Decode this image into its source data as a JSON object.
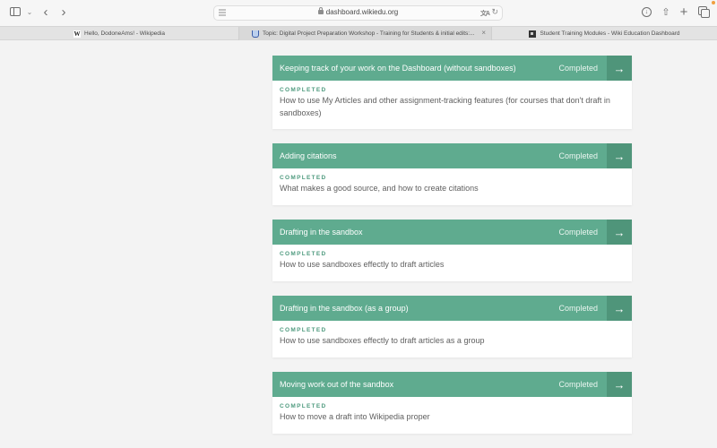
{
  "browser": {
    "url": "dashboard.wikiedu.org",
    "icons": {
      "sidebar": "sidebar-icon",
      "back": "‹",
      "forward": "›",
      "chevron_down": "⌄",
      "download": "↓",
      "share": "⇧",
      "new_tab": "+",
      "reload": "↻",
      "translate": "文A"
    },
    "tabs": [
      {
        "label": "Hello, DodoneAms! - Wikipedia",
        "favicon": "W",
        "active": false
      },
      {
        "label": "Topic: Digital Project Preparation Workshop - Training for Students & initial edits:...",
        "favicon": "U",
        "active": true,
        "close": "×"
      },
      {
        "label": "Student Training Modules - Wiki Education Dashboard",
        "favicon": "wiki-edu",
        "active": false
      }
    ]
  },
  "theme": {
    "header_color": "#5fab8f",
    "arrow_color": "#4f957a",
    "completed_label_color": "#4e9a7e"
  },
  "modules": [
    {
      "title": "Keeping track of your work on the Dashboard (without sandboxes)",
      "status": "Completed",
      "arrow": "→",
      "label": "COMPLETED",
      "description": "How to use My Articles and other assignment-tracking features (for courses that don't draft in sandboxes)"
    },
    {
      "title": "Adding citations",
      "status": "Completed",
      "arrow": "→",
      "label": "COMPLETED",
      "description": "What makes a good source, and how to create citations"
    },
    {
      "title": "Drafting in the sandbox",
      "status": "Completed",
      "arrow": "→",
      "label": "COMPLETED",
      "description": "How to use sandboxes effectly to draft articles"
    },
    {
      "title": "Drafting in the sandbox (as a group)",
      "status": "Completed",
      "arrow": "→",
      "label": "COMPLETED",
      "description": "How to use sandboxes effectly to draft articles as a group"
    },
    {
      "title": "Moving work out of the sandbox",
      "status": "Completed",
      "arrow": "→",
      "label": "COMPLETED",
      "description": "How to move a draft into Wikipedia proper"
    }
  ]
}
